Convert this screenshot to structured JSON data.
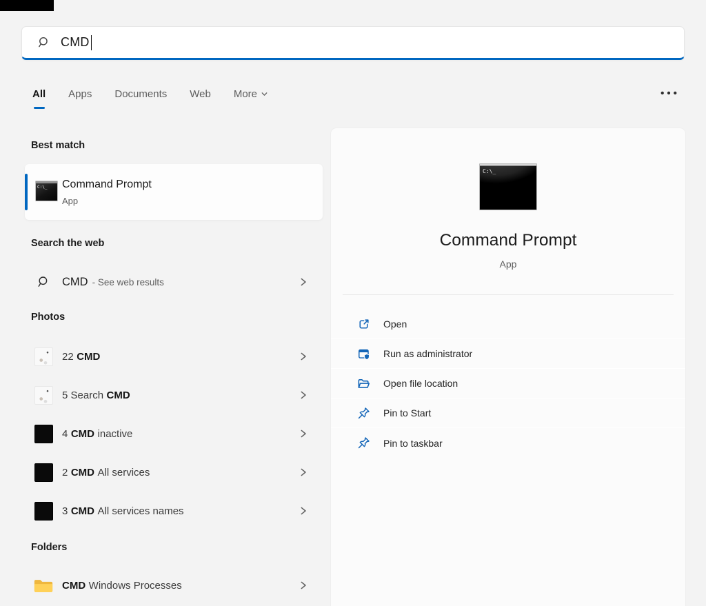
{
  "colors": {
    "accent": "#0067c0",
    "action_blue": "#1466b8",
    "left_bg": "#f3f3f3",
    "panel_bg": "#fbfbfb"
  },
  "search_bar": {
    "value": "CMD"
  },
  "tabs": {
    "items": [
      {
        "label": "All"
      },
      {
        "label": "Apps"
      },
      {
        "label": "Documents"
      },
      {
        "label": "Web"
      },
      {
        "label": "More"
      }
    ],
    "overflow_label": "•••"
  },
  "icons": {
    "cmd_small_text": "C:\\_",
    "cmd_large_text": "C:\\_"
  },
  "left_panel": {
    "best_match": {
      "heading": "Best match",
      "item": {
        "title": "Command Prompt",
        "subtitle": "App"
      }
    },
    "web_section": {
      "heading": "Search the web",
      "item": {
        "query": "CMD",
        "suffix": "- See web results"
      }
    },
    "photos_section": {
      "heading": "Photos",
      "items": [
        {
          "pre": "22",
          "bold": "CMD",
          "post": ""
        },
        {
          "pre": "5 Search",
          "bold": "CMD",
          "post": ""
        },
        {
          "pre": "4",
          "bold": "CMD",
          "post": "inactive"
        },
        {
          "pre": "2",
          "bold": "CMD",
          "post": "All services"
        },
        {
          "pre": "3",
          "bold": "CMD",
          "post": "All services names"
        }
      ]
    },
    "folders_section": {
      "heading": "Folders",
      "items": [
        {
          "pre": "",
          "bold": "CMD",
          "post": "Windows Processes"
        }
      ]
    }
  },
  "right_panel": {
    "title": "Command Prompt",
    "subtitle": "App",
    "actions": [
      {
        "label": "Open"
      },
      {
        "label": "Run as administrator"
      },
      {
        "label": "Open file location"
      },
      {
        "label": "Pin to Start"
      },
      {
        "label": "Pin to taskbar"
      }
    ]
  }
}
